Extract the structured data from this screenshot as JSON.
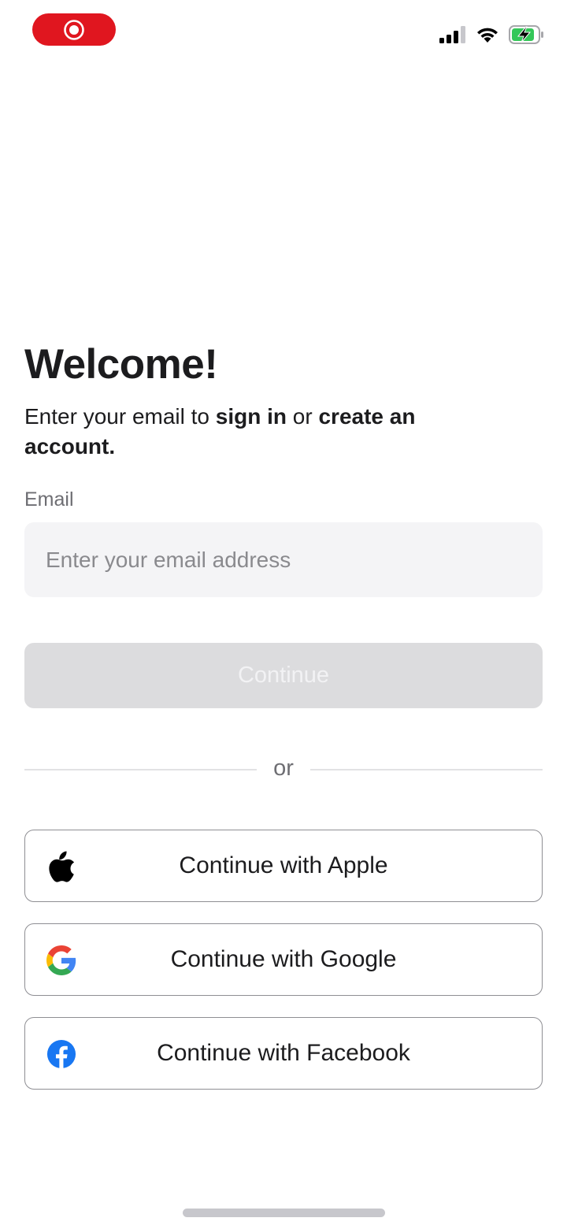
{
  "status_bar": {
    "record_icon": "screen-record-icon",
    "signal_icon": "cellular-signal-icon",
    "wifi_icon": "wifi-icon",
    "battery_icon": "battery-charging-icon",
    "record_color": "#e0161f",
    "battery_color": "#34c759"
  },
  "welcome": {
    "title": "Welcome!",
    "subtitle_part1": "Enter your email to ",
    "subtitle_bold1": "sign in",
    "subtitle_part2": " or ",
    "subtitle_bold2": "create an account",
    "subtitle_end": "."
  },
  "email": {
    "label": "Email",
    "value": "",
    "placeholder": "Enter your email address"
  },
  "continue_label": "Continue",
  "divider_text": "or",
  "social": {
    "apple": {
      "label": "Continue with Apple",
      "icon": "apple-icon"
    },
    "google": {
      "label": "Continue with Google",
      "icon": "google-icon"
    },
    "facebook": {
      "label": "Continue with Facebook",
      "icon": "facebook-icon",
      "color": "#1877f2"
    }
  }
}
